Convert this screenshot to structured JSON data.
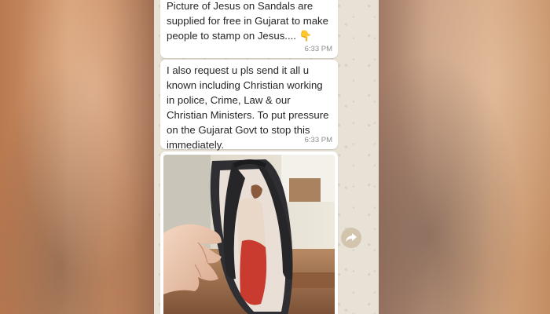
{
  "chat": {
    "messages": [
      {
        "text": "Picture of Jesus on Sandals are\nsupplied for free in Gujarat to make\npeople to stamp on Jesus.... 👇",
        "time": "6:33 PM"
      },
      {
        "text": "I also request u pls send it all u\nknown including Christian working\nin police, Crime, Law & our\nChristian Ministers. To put pressure\non the Gujarat Govt to stop this\nimmediately.",
        "time": "6:33 PM"
      }
    ],
    "image_message": {
      "description_icon": "photo-of-sandal"
    },
    "forward_icon": "share-forward-icon"
  },
  "colors": {
    "chat_background": "#e7e1d6",
    "bubble": "#ffffff",
    "forward_button": "#d3c4ae"
  }
}
